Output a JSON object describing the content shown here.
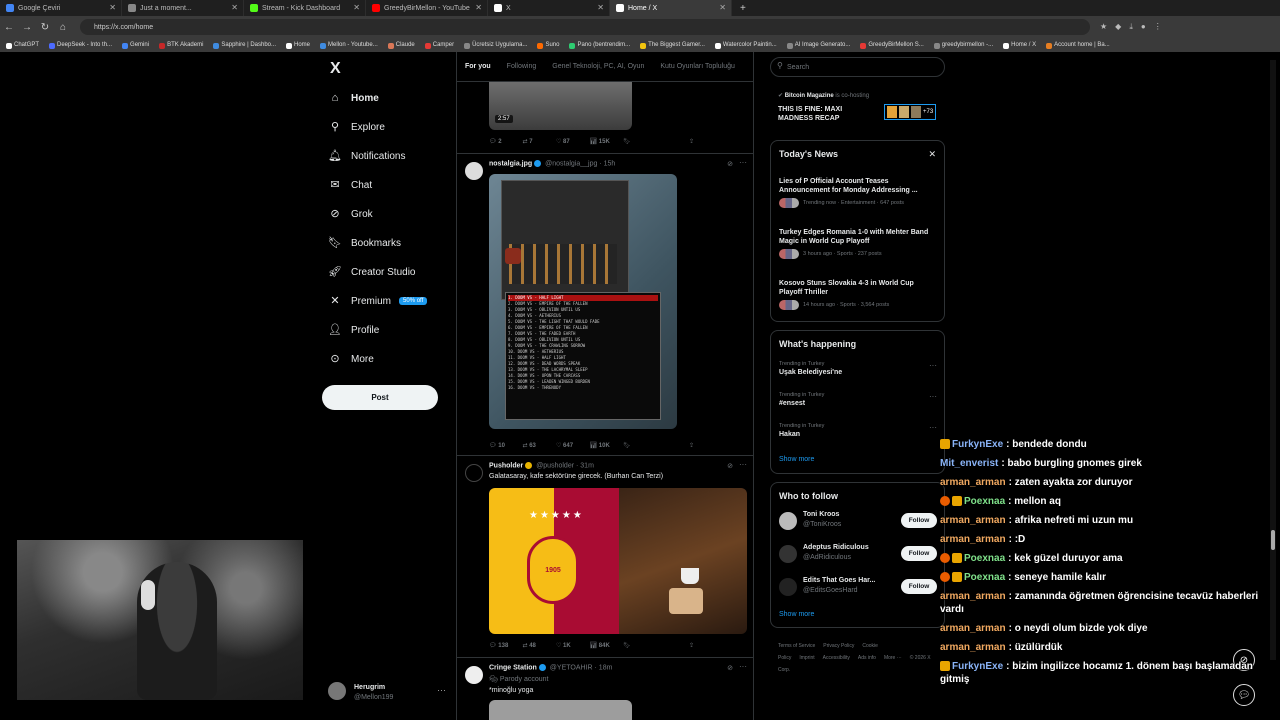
{
  "browser": {
    "tabs": [
      {
        "title": "Google Çeviri",
        "color": "#4285f4"
      },
      {
        "title": "Just a moment...",
        "color": "#888888"
      },
      {
        "title": "Stream - Kick Dashboard",
        "color": "#53fc18"
      },
      {
        "title": "GreedyBirMellon - YouTube",
        "color": "#ff0000"
      },
      {
        "title": "X",
        "color": "#ffffff"
      },
      {
        "title": "Home / X",
        "color": "#ffffff"
      }
    ],
    "url": "https://x.com/home",
    "bookmarks": [
      {
        "label": "ChatGPT",
        "color": "#ffffff"
      },
      {
        "label": "DeepSeek - Into th...",
        "color": "#4d6bfe"
      },
      {
        "label": "Gemini",
        "color": "#4285f4"
      },
      {
        "label": "BTK Akademi",
        "color": "#c62828"
      },
      {
        "label": "Sapphire | Dashbo...",
        "color": "#3f8be0"
      },
      {
        "label": "Home",
        "color": "#ffffff"
      },
      {
        "label": "Mellon - Youtube...",
        "color": "#3f8be0"
      },
      {
        "label": "Claude",
        "color": "#d97757"
      },
      {
        "label": "Camper",
        "color": "#e53935"
      },
      {
        "label": "Ücretsiz Uygulama...",
        "color": "#888888"
      },
      {
        "label": "Suno",
        "color": "#ff6a00"
      },
      {
        "label": "Pano (bentrendim...",
        "color": "#2ecc71"
      },
      {
        "label": "The Biggest Gamer...",
        "color": "#f1c40f"
      },
      {
        "label": "Watercolor Paintin...",
        "color": "#ffffff"
      },
      {
        "label": "AI Image Generato...",
        "color": "#888888"
      },
      {
        "label": "GreedyBirMellon S...",
        "color": "#e53935"
      },
      {
        "label": "greedybirmellon -...",
        "color": "#888888"
      },
      {
        "label": "Home / X",
        "color": "#ffffff"
      },
      {
        "label": "Account home | Ba...",
        "color": "#e67e22"
      }
    ]
  },
  "sidebar": {
    "logo": "X",
    "items": [
      {
        "label": "Home",
        "icon": "home-icon",
        "glyph": "⌂"
      },
      {
        "label": "Explore",
        "icon": "search-icon",
        "glyph": "⚲"
      },
      {
        "label": "Notifications",
        "icon": "bell-icon",
        "glyph": "🔔︎"
      },
      {
        "label": "Chat",
        "icon": "mail-icon",
        "glyph": "✉"
      },
      {
        "label": "Grok",
        "icon": "grok-icon",
        "glyph": "⊘"
      },
      {
        "label": "Bookmarks",
        "icon": "bookmark-icon",
        "glyph": "🔖︎"
      },
      {
        "label": "Creator Studio",
        "icon": "rocket-icon",
        "glyph": "🚀︎"
      },
      {
        "label": "Premium",
        "icon": "x-icon",
        "glyph": "✕"
      },
      {
        "label": "Profile",
        "icon": "person-icon",
        "glyph": "👤︎"
      },
      {
        "label": "More",
        "icon": "more-circle-icon",
        "glyph": "⊙"
      }
    ],
    "premium_badge": "50% off",
    "post_label": "Post",
    "account": {
      "name": "Herugrim",
      "handle": "@Mellon199"
    }
  },
  "feed": {
    "tabs": [
      "For you",
      "Following",
      "Genel Teknoloji, PC, AI, Oyun",
      "Kutu Oyunları Topluluğu"
    ],
    "top_media_duration": "2:57",
    "top_actions": {
      "replies": "2",
      "reposts": "7",
      "likes": "87",
      "views": "15K"
    },
    "tweets": [
      {
        "name": "nostalgia.jpg",
        "handle": "@nostalgia__jpg",
        "time": "15h",
        "text": "",
        "actions": {
          "replies": "10",
          "reposts": "63",
          "likes": "647",
          "views": "10K"
        },
        "playlist": [
          "1. DOOM VS - HALF LIGHT",
          "2. DOOM VS - EMPIRE OF THE FALLEN",
          "3. DOOM VS - OBLIVION UNTIL US",
          "4. DOOM VS - AETHERIUS",
          "5. DOOM VS - THE LIGHT THAT WOULD FADE",
          "6. DOOM VS - EMPIRE OF THE FALLEN",
          "7. DOOM VS - THE FADED EARTH",
          "8. DOOM VS - OBLIVION UNTIL US",
          "9. DOOM VS - THE CRAWLING SORROW",
          "10. DOOM VS - AETHERIUS",
          "11. DOOM VS - HALF LIGHT",
          "12. DOOM VS - DEAD WORDS SPEAK",
          "13. DOOM VS - THE LACHRYMAL SLEEP",
          "14. DOOM VS - UPON THE CARCASS",
          "15. DOOM VS - LEADEN WINGED BURDEN",
          "16. DOOM VS - THRENODY"
        ]
      },
      {
        "name": "Pusholder",
        "handle": "@pusholder",
        "time": "31m",
        "text": "Galatasaray, kafe sektörüne girecek. (Burhan Can Terzi)",
        "crest_year": "1905",
        "actions": {
          "replies": "138",
          "reposts": "48",
          "likes": "1K",
          "views": "84K"
        }
      },
      {
        "name": "Cringe Station",
        "handle": "@YETOAHIR",
        "time": "18m",
        "badge": "Parody account",
        "text": "*minoğlu yoga"
      }
    ]
  },
  "right": {
    "search_placeholder": "Search",
    "ad": {
      "source": "Bitcoin Magazine",
      "suffix": "is co-hosting",
      "title": "THIS IS FINE: MAXI MADNESS RECAP",
      "count": "+73"
    },
    "news": {
      "title": "Today's News",
      "items": [
        {
          "title": "Lies of P Official Account Teases Announcement for Monday Addressing ...",
          "meta": "Trending now · Entertainment · 647 posts"
        },
        {
          "title": "Turkey Edges Romania 1-0 with Mehter Band Magic in World Cup Playoff",
          "meta": "3 hours ago · Sports · 237 posts"
        },
        {
          "title": "Kosovo Stuns Slovakia 4-3 in World Cup Playoff Thriller",
          "meta": "14 hours ago · Sports · 3,564 posts"
        }
      ]
    },
    "happening": {
      "title": "What's happening",
      "items": [
        {
          "context": "Trending in Turkey",
          "name": "Uşak Belediyesi'ne"
        },
        {
          "context": "Trending in Turkey",
          "name": "#ensest"
        },
        {
          "context": "Trending in Turkey",
          "name": "Hakan"
        }
      ],
      "show_more": "Show more"
    },
    "who_to_follow": {
      "title": "Who to follow",
      "items": [
        {
          "name": "Toni Kroos",
          "handle": "@ToniKroos"
        },
        {
          "name": "Adeptus Ridiculous",
          "handle": "@AdRidiculous"
        },
        {
          "name": "Edits That Goes Har...",
          "handle": "@EditsGoesHard"
        }
      ],
      "follow_label": "Follow",
      "show_more": "Show more"
    },
    "footer": [
      "Terms of Service",
      "Privacy Policy",
      "Cookie Policy",
      "Imprint",
      "Accessibility",
      "Ads info",
      "More ···",
      "© 2026 X Corp."
    ]
  },
  "chat": [
    {
      "badges": [
        "crown"
      ],
      "user": "FurkynExe",
      "color": "#8ab4f8",
      "msg": "bendede dondu"
    },
    {
      "badges": [],
      "user": "Mit_enverist",
      "color": "#8ab4f8",
      "msg": "babo burgling gnomes girek"
    },
    {
      "badges": [],
      "user": "arman_arman",
      "color": "#f0a860",
      "msg": "zaten ayakta zor duruyor"
    },
    {
      "badges": [
        "gift",
        "crown"
      ],
      "user": "Poexnaa",
      "color": "#7fe08a",
      "msg": "mellon aq"
    },
    {
      "badges": [],
      "user": "arman_arman",
      "color": "#f0a860",
      "msg": "afrika nefreti mi uzun mu"
    },
    {
      "badges": [],
      "user": "arman_arman",
      "color": "#f0a860",
      "msg": ":D"
    },
    {
      "badges": [
        "gift",
        "crown"
      ],
      "user": "Poexnaa",
      "color": "#7fe08a",
      "msg": "kek güzel duruyor ama"
    },
    {
      "badges": [
        "gift",
        "crown"
      ],
      "user": "Poexnaa",
      "color": "#7fe08a",
      "msg": "seneye hamile kalır"
    },
    {
      "badges": [],
      "user": "arman_arman",
      "color": "#f0a860",
      "msg": "zamanında öğretmen öğrencisine tecavüz haberleri vardı"
    },
    {
      "badges": [],
      "user": "arman_arman",
      "color": "#f0a860",
      "msg": "o neydi olum bizde yok diye"
    },
    {
      "badges": [],
      "user": "arman_arman",
      "color": "#f0a860",
      "msg": "üzülürdük"
    },
    {
      "badges": [
        "crown"
      ],
      "user": "FurkynExe",
      "color": "#8ab4f8",
      "msg": "bizim ingilizce hocamız 1. dönem başı başlamadan gitmiş"
    }
  ]
}
